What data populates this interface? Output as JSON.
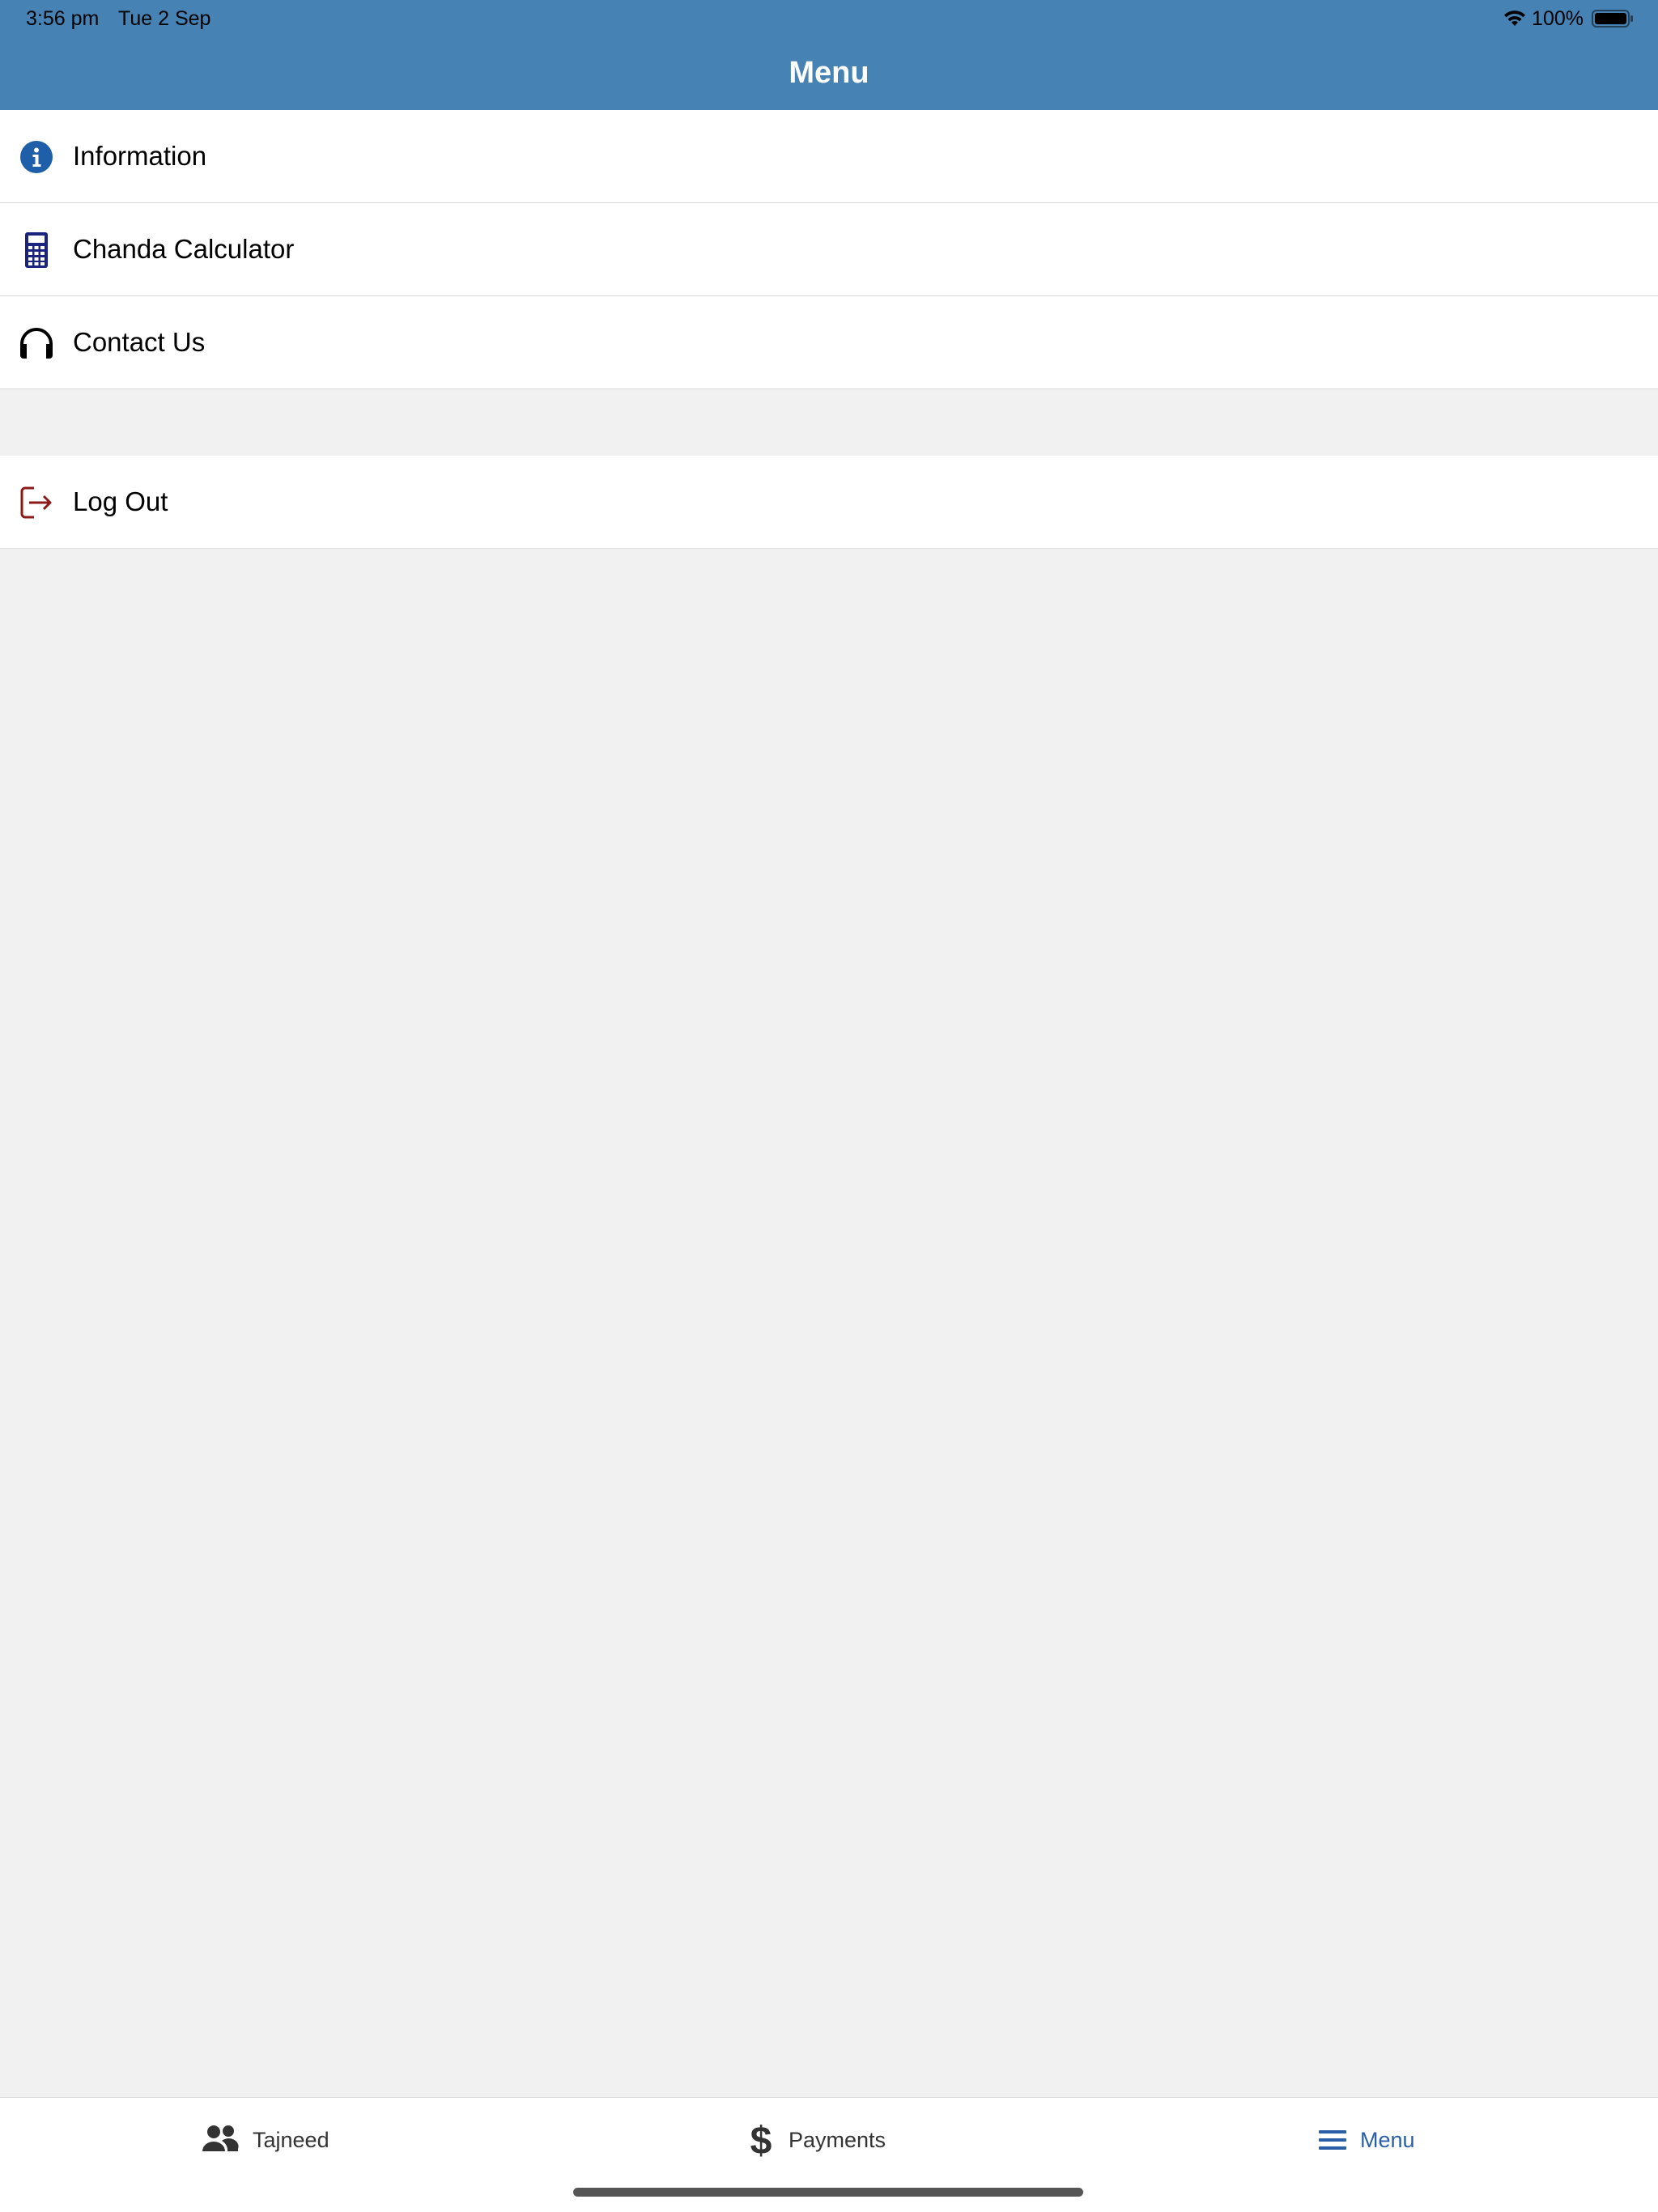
{
  "status_bar": {
    "time": "3:56 pm",
    "date": "Tue 2 Sep",
    "battery": "100%"
  },
  "header": {
    "title": "Menu"
  },
  "menu": {
    "items": [
      {
        "label": "Information",
        "icon": "info-icon",
        "color": "#1f5ea8"
      },
      {
        "label": "Chanda Calculator",
        "icon": "calculator-icon",
        "color": "#1a237e"
      },
      {
        "label": "Contact Us",
        "icon": "headphones-icon",
        "color": "#000000"
      }
    ],
    "logout": {
      "label": "Log Out",
      "icon": "logout-icon",
      "color": "#8b1a1a"
    }
  },
  "tab_bar": {
    "tabs": [
      {
        "label": "Tajneed",
        "icon": "users-icon",
        "active": false
      },
      {
        "label": "Payments",
        "icon": "dollar-icon",
        "active": false
      },
      {
        "label": "Menu",
        "icon": "hamburger-icon",
        "active": true
      }
    ],
    "active_color": "#2a5fa8"
  },
  "colors": {
    "header_bg": "#4682b4",
    "page_bg": "#f1f1f1"
  }
}
